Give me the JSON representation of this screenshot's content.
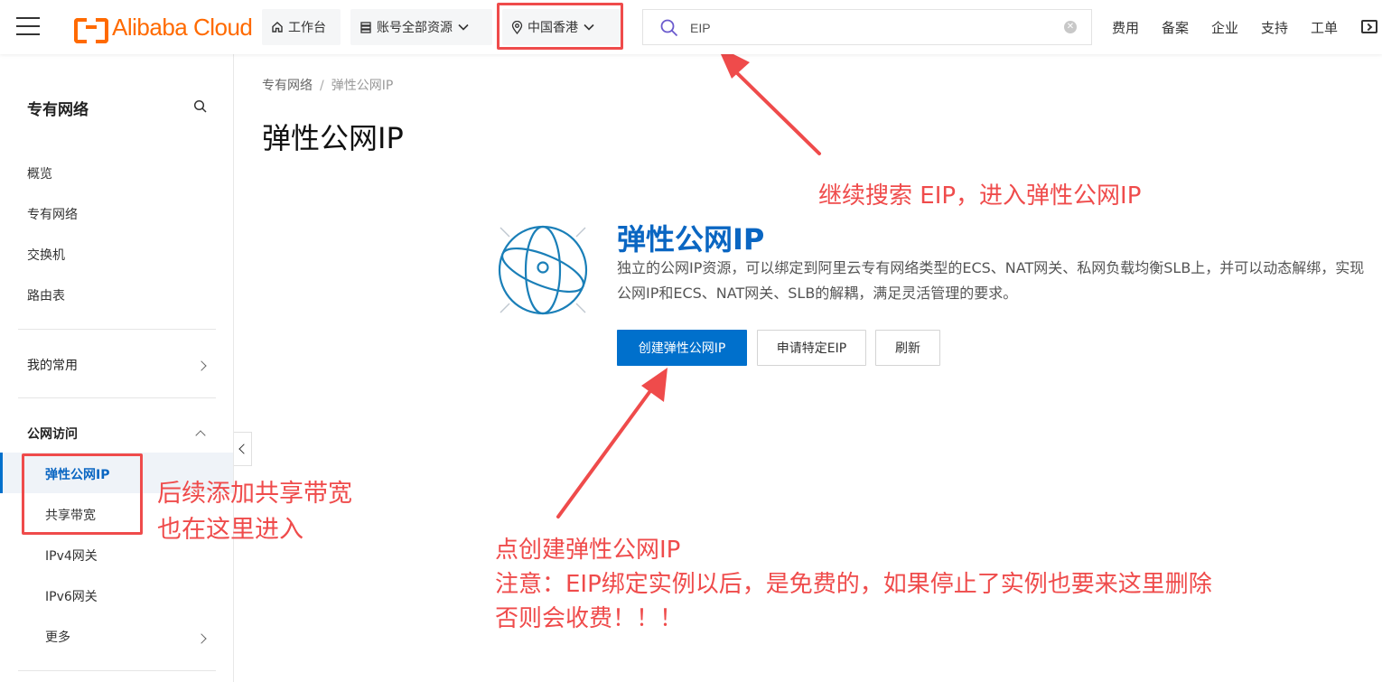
{
  "header": {
    "logo_text": "Alibaba Cloud",
    "workbench_label": "工作台",
    "resources_label": "账号全部资源",
    "region_label": "中国香港",
    "search": {
      "value": "EIP"
    },
    "links": [
      "费用",
      "备案",
      "企业",
      "支持",
      "工单"
    ]
  },
  "sidebar": {
    "title": "专有网络",
    "items": [
      "概览",
      "专有网络",
      "交换机",
      "路由表"
    ],
    "favorites_label": "我的常用",
    "public_access_label": "公网访问",
    "public_sub": [
      "弹性公网IP",
      "共享带宽",
      "IPv4网关",
      "IPv6网关"
    ],
    "more_label": "更多"
  },
  "main": {
    "breadcrumb": [
      "专有网络",
      "/",
      "弹性公网IP"
    ],
    "page_title": "弹性公网IP",
    "hero_title": "弹性公网IP",
    "hero_desc": "独立的公网IP资源，可以绑定到阿里云专有网络类型的ECS、NAT网关、私网负载均衡SLB上，并可以动态解绑，实现公网IP和ECS、NAT网关、SLB的解耦，满足灵活管理的要求。",
    "buttons": {
      "create": "创建弹性公网IP",
      "apply": "申请特定EIP",
      "refresh": "刷新"
    }
  },
  "annotations": {
    "search_note": "继续搜索 EIP，进入弹性公网IP",
    "side_note": [
      "后续添加共享带宽",
      "也在这里进入"
    ],
    "create_note": [
      "点创建弹性公网IP",
      "注意：EIP绑定实例以后，是免费的，如果停止了实例也要来这里删除",
      "否则会收费！！！"
    ],
    "color": "#ef4b4b"
  },
  "theme": {
    "accent": "#0070cc",
    "brand": "#ff6a00"
  }
}
